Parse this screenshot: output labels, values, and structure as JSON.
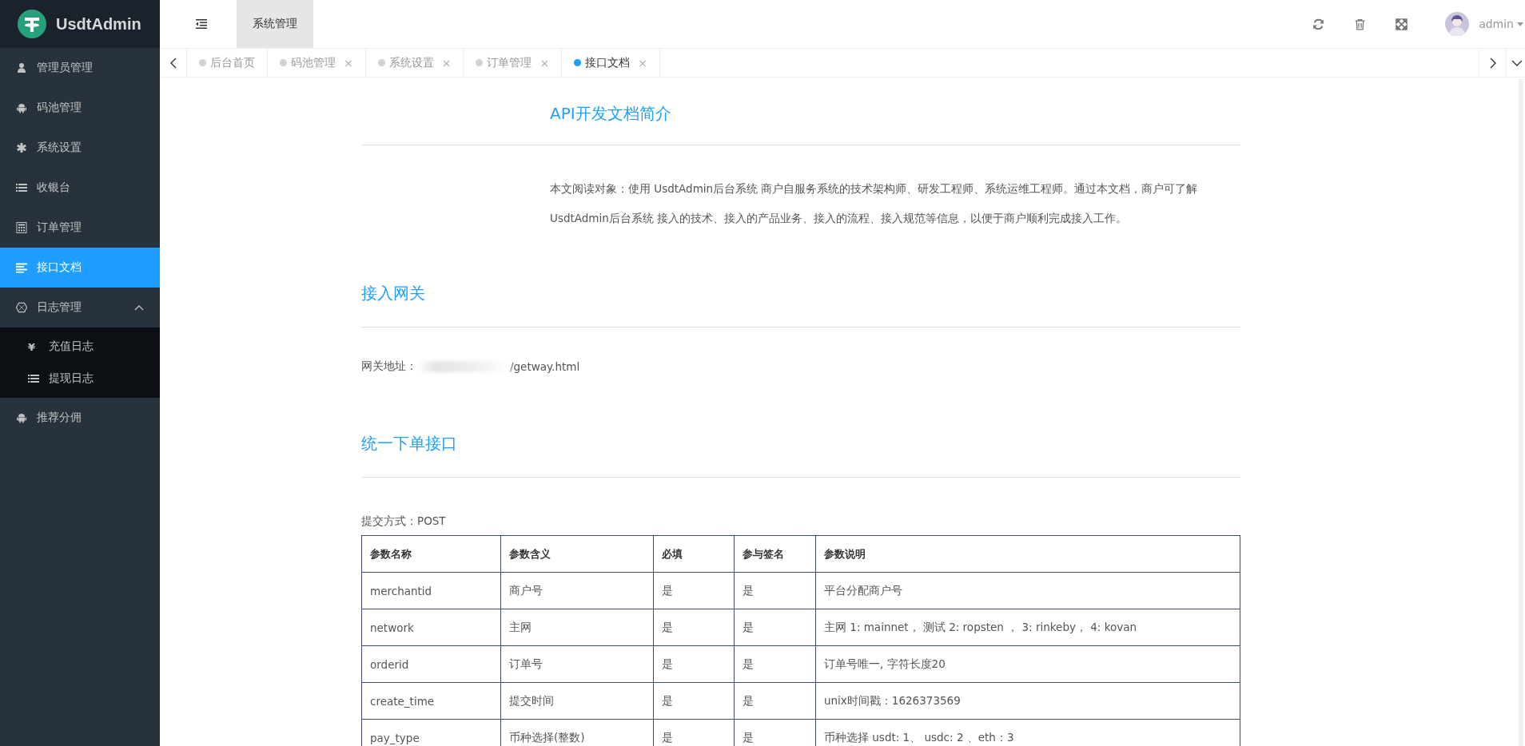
{
  "brand": {
    "name": "UsdtAdmin"
  },
  "top_menu": [
    {
      "label": "系统管理",
      "selected": true
    }
  ],
  "user": {
    "name": "admin"
  },
  "sidebar": {
    "items": [
      {
        "label": "管理员管理",
        "selected": false
      },
      {
        "label": "码池管理",
        "selected": false
      },
      {
        "label": "系统设置",
        "selected": false
      },
      {
        "label": "收银台",
        "selected": false
      },
      {
        "label": "订单管理",
        "selected": false
      },
      {
        "label": "接口文档",
        "selected": true
      },
      {
        "label": "日志管理",
        "selected": false,
        "expanded": true,
        "children": [
          {
            "label": "充值日志",
            "glyph": "¥",
            "selected": false
          },
          {
            "label": "提现日志",
            "selected": false
          }
        ]
      },
      {
        "label": "推荐分佣",
        "selected": false
      }
    ]
  },
  "tabs": [
    {
      "label": "后台首页",
      "selected": false
    },
    {
      "label": "码池管理",
      "selected": false,
      "close": "×"
    },
    {
      "label": "系统设置",
      "selected": false,
      "close": "×"
    },
    {
      "label": "订单管理",
      "selected": false,
      "close": "×"
    },
    {
      "label": "接口文档",
      "selected": true,
      "close": "×"
    }
  ],
  "doc": {
    "title": "API开发文档简介",
    "intro": [
      "本文阅读对象：使用 UsdtAdmin后台系统 商户自服务系统的技术架构师、研发工程师、系统运维工程师。通过本文档，商户可了解",
      "UsdtAdmin后台系统 接入的技术、接入的产品业务、接入的流程、接入规范等信息，以便于商户顺利完成接入工作。"
    ],
    "gateway": {
      "heading": "接入网关",
      "label": "网关地址：",
      "value": "/getway.html"
    },
    "order": {
      "heading": "统一下单接口",
      "method": "提交方式：POST",
      "table": {
        "columns": [
          "参数名称",
          "参数含义",
          "必填",
          "参与签名",
          "参数说明"
        ],
        "rows": [
          [
            "merchantid",
            "商户号",
            "是",
            "是",
            "平台分配商户号"
          ],
          [
            "network",
            "主网",
            "是",
            "是",
            "主网 1: mainnet， 测试 2: ropsten ，  3: rinkeby，  4: kovan"
          ],
          [
            "orderid",
            "订单号",
            "是",
            "是",
            "订单号唯一, 字符长度20"
          ],
          [
            "create_time",
            "提交时间",
            "是",
            "是",
            "unix时间戳：1626373569"
          ],
          [
            "pay_type",
            "币种选择(整数)",
            "是",
            "是",
            "币种选择 usdt: 1、 usdc: 2 、eth：3"
          ]
        ]
      }
    }
  }
}
